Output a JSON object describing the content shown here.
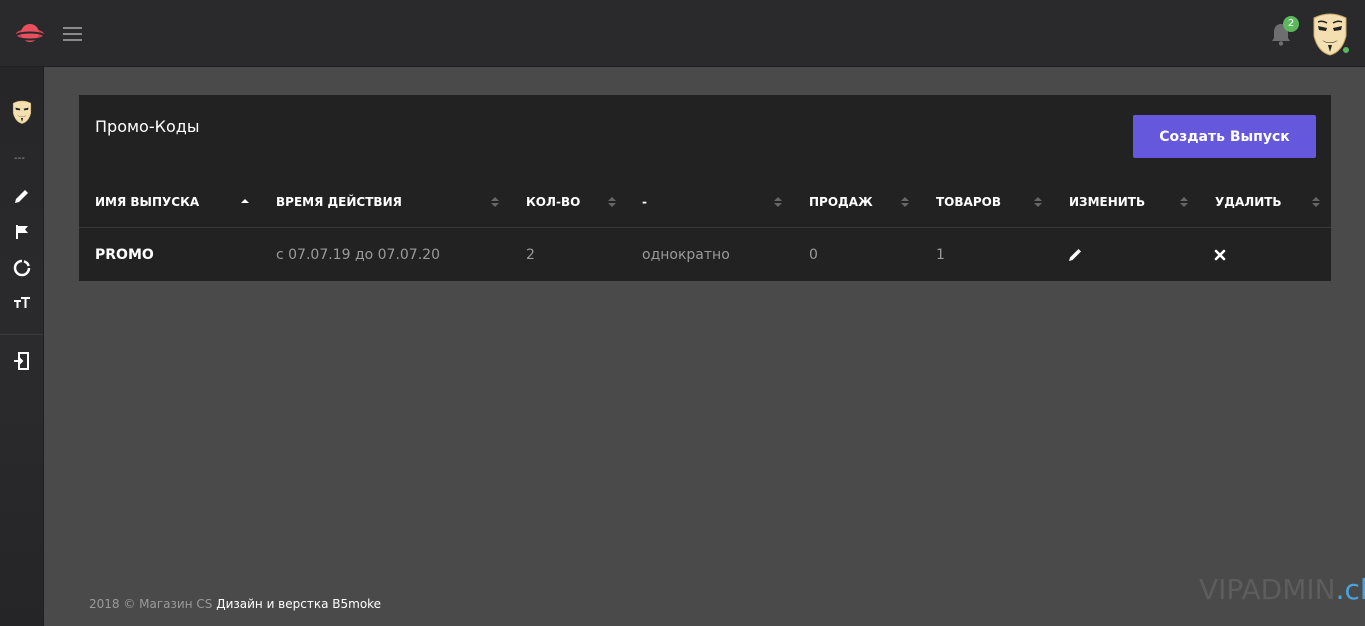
{
  "header": {
    "notification_count": "2"
  },
  "card": {
    "title": "Промо-Коды",
    "create_button_label": "Создать Выпуск"
  },
  "table": {
    "columns": [
      "ИМЯ ВЫПУСКА",
      "ВРЕМЯ ДЕЙСТВИЯ",
      "КОЛ-ВО",
      "-",
      "ПРОДАЖ",
      "ТОВАРОВ",
      "ИЗМЕНИТЬ",
      "УДАЛИТЬ"
    ],
    "rows": [
      {
        "name": "PROMO",
        "period": "с 07.07.19 до 07.07.20",
        "quantity": "2",
        "type": "однократно",
        "sales": "0",
        "products": "1"
      }
    ]
  },
  "sidebar": {
    "dots": "---",
    "icons": [
      "avatar",
      "pencil-icon",
      "flag-icon",
      "circle-notch-icon",
      "text-size-icon",
      "logout-icon"
    ]
  },
  "footer": {
    "prefix": "2018 © Магазин CS",
    "link": "Дизайн и верстка B5moke"
  },
  "watermark": {
    "main": "VIPADMIN",
    "suffix": ".club"
  }
}
